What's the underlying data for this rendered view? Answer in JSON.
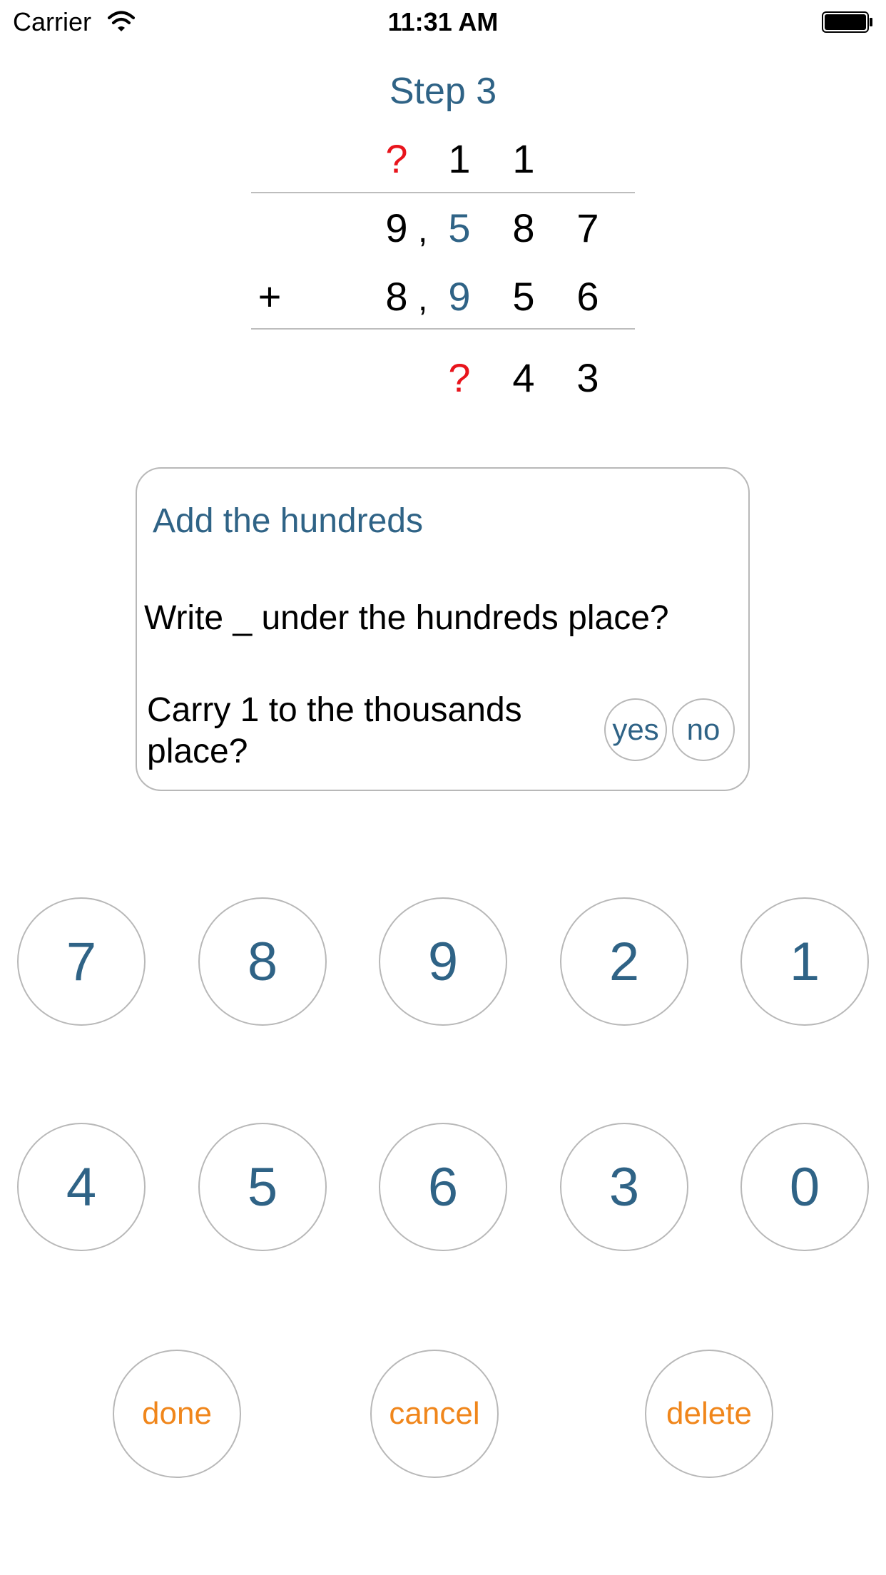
{
  "status_bar": {
    "carrier": "Carrier",
    "time": "11:31 AM",
    "wifi_icon": "wifi-icon",
    "battery_icon": "battery-icon"
  },
  "title": "Step 3",
  "problem": {
    "carry_row": [
      "?",
      "1",
      "1"
    ],
    "addend1": {
      "thousands": "9",
      "comma": ",",
      "hundreds": "5",
      "tens": "8",
      "ones": "7"
    },
    "addend2": {
      "operator": "+",
      "thousands": "8",
      "comma": ",",
      "hundreds": "9",
      "tens": "5",
      "ones": "6"
    },
    "result": {
      "hundreds": "?",
      "tens": "4",
      "ones": "3"
    }
  },
  "hint": {
    "title": "Add the hundreds",
    "write_prompt": "Write _ under the hundreds place?",
    "carry_prompt": "Carry 1 to the thousands place?",
    "yes_label": "yes",
    "no_label": "no"
  },
  "keypad": {
    "row1": [
      "7",
      "8",
      "9",
      "2",
      "1"
    ],
    "row2": [
      "4",
      "5",
      "6",
      "3",
      "0"
    ]
  },
  "actions": {
    "done": "done",
    "cancel": "cancel",
    "delete": "delete"
  },
  "colors": {
    "accent_blue": "#2f6386",
    "unknown_red": "#e8141c",
    "action_orange": "#f0861b",
    "border_gray": "#b8b8b8"
  }
}
